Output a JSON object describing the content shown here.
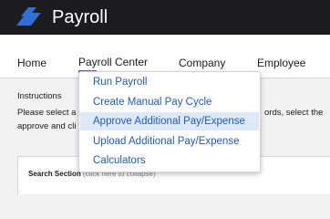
{
  "app": {
    "title": "Payroll"
  },
  "colors": {
    "header": "#1c1c1e",
    "logo": "#2f6fd6",
    "link": "#1f5bb8",
    "hover": "#dde9f7"
  },
  "nav": {
    "items": [
      {
        "label": "Home"
      },
      {
        "label": "Payroll Center"
      },
      {
        "label": "Company"
      },
      {
        "label": "Employee"
      }
    ],
    "active": "Payroll Center"
  },
  "instructions": {
    "heading": "Instructions",
    "line1_left": "Please select a",
    "line1_right": "ords, select the",
    "line2_left": "approve and cli"
  },
  "search": {
    "title": "Search Section",
    "hint": "(click here to collapse)"
  },
  "dropdown": {
    "items": [
      {
        "label": "Run Payroll"
      },
      {
        "label": "Create Manual Pay Cycle"
      },
      {
        "label": "Approve Additional Pay/Expense"
      },
      {
        "label": "Upload Additional Pay/Expense"
      },
      {
        "label": "Calculators"
      }
    ],
    "highlighted": "Approve Additional Pay/Expense"
  }
}
